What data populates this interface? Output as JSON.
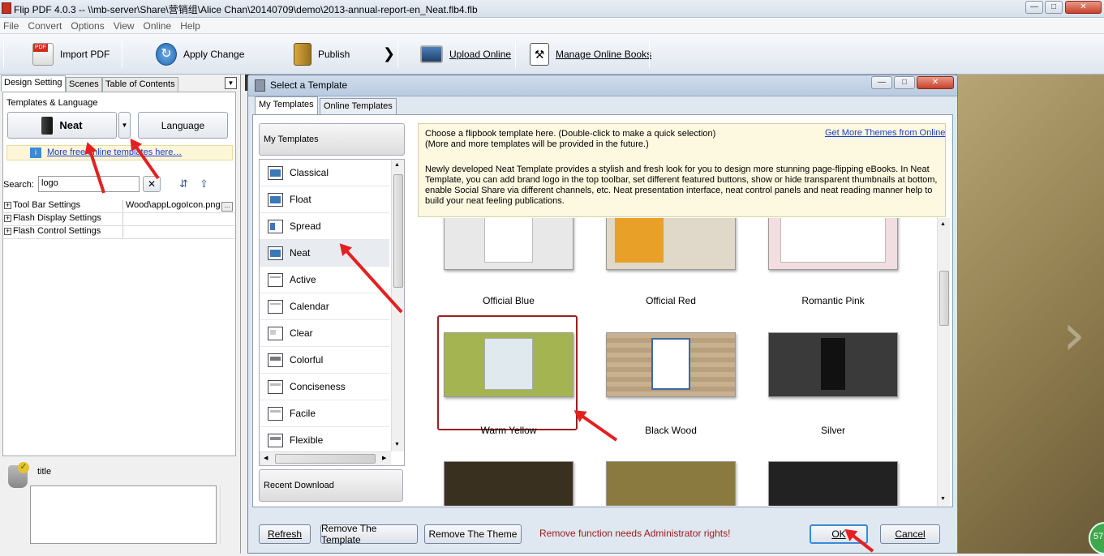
{
  "window": {
    "title": "Flip PDF 4.0.3  -- \\\\mb-server\\Share\\营销组\\Alice Chan\\20140709\\demo\\2013-annual-report-en_Neat.flb4.flb"
  },
  "menu": [
    "File",
    "Convert",
    "Options",
    "View",
    "Online",
    "Help"
  ],
  "toolbar": {
    "import": "Import PDF",
    "apply": "Apply Change",
    "publish": "Publish",
    "upload": "Upload Online",
    "manage": "Manage Online Books"
  },
  "left": {
    "tabs": [
      "Design Setting",
      "Scenes",
      "Table of Contents"
    ],
    "templates_lang_label": "Templates & Language",
    "template_button": "Neat",
    "language_button": "Language",
    "more_link": "More free online templates here…",
    "search_label": "Search:",
    "search_value": "logo",
    "props": [
      {
        "name": "Tool Bar Settings",
        "value": "Wood\\appLogoIcon.png"
      },
      {
        "name": "Flash Display Settings",
        "value": ""
      },
      {
        "name": "Flash Control Settings",
        "value": ""
      }
    ],
    "title_label": "title"
  },
  "dialog": {
    "title": "Select a Template",
    "tabs": [
      "My Templates",
      "Online Templates"
    ],
    "my_templates_header": "My Templates",
    "recent_download": "Recent Download",
    "templates": [
      "Classical",
      "Float",
      "Spread",
      "Neat",
      "Active",
      "Calendar",
      "Clear",
      "Colorful",
      "Conciseness",
      "Facile",
      "Flexible"
    ],
    "selected_template": "Neat",
    "info_line1": "Choose a flipbook template here. (Double-click to make a quick selection)",
    "info_line2": "(More and more templates will be provided in the future.)",
    "info_link": "Get More Themes from Online",
    "info_desc": "Newly developed Neat Template provides a stylish and fresh look for you to design more stunning page-flipping eBooks. In Neat Template, you can add brand logo in the top toolbar, set different featured buttons, show or hide transparent thumbnails at bottom, enable Social Share via different channels, etc. Neat presentation interface, neat control panels and neat reading manner help to build your neat feeling publications.",
    "themes": [
      "Official Blue",
      "Official Red",
      "Romantic Pink",
      "Warm Yellow",
      "Black Wood",
      "Silver"
    ],
    "selected_theme": "Warm Yellow",
    "thumb_colors": [
      "#e8e8e8",
      "#e0d8c8",
      "#f2dde0",
      "#a4b450",
      "#c8b090",
      "#2a2a2a"
    ],
    "buttons": {
      "refresh": "Refresh",
      "remove_template": "Remove The Template",
      "remove_theme": "Remove The Theme",
      "ok": "OK",
      "cancel": "Cancel"
    },
    "admin_note": "Remove function needs Administrator rights!",
    "badge": "57"
  }
}
